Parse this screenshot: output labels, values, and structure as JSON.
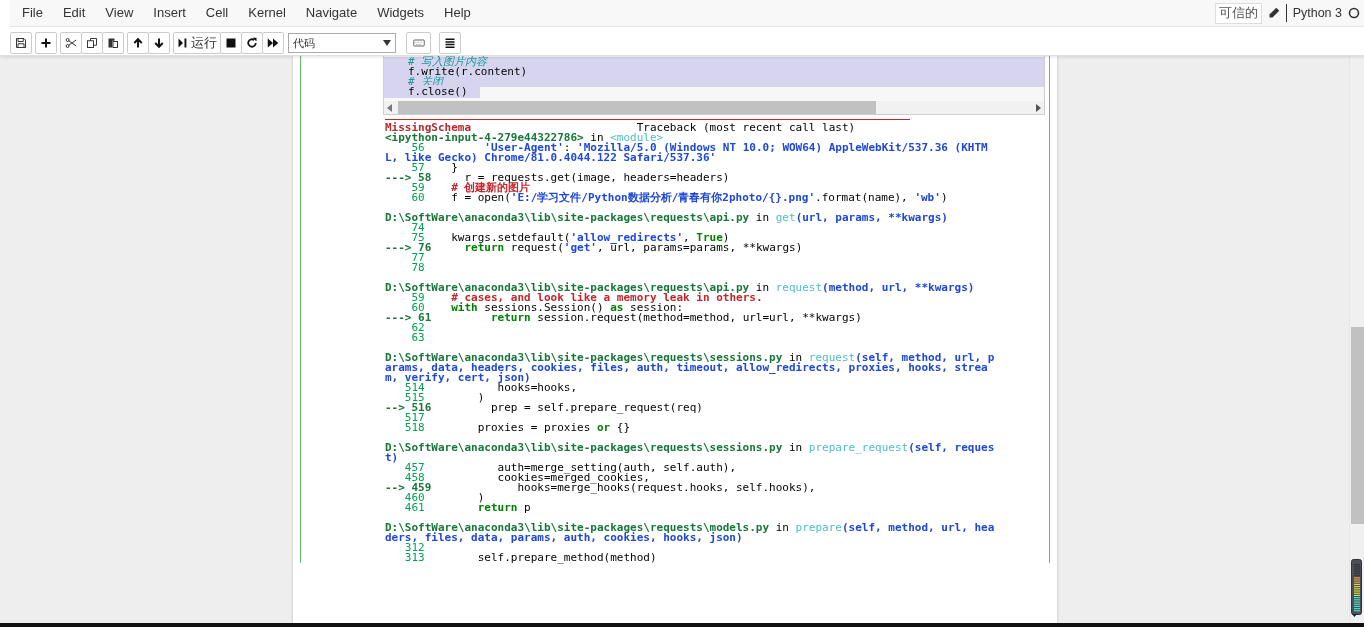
{
  "menu": [
    "File",
    "Edit",
    "View",
    "Insert",
    "Cell",
    "Kernel",
    "Navigate",
    "Widgets",
    "Help"
  ],
  "header": {
    "trusted": "可信的",
    "kernel_name": "Python 3",
    "kernel_busy": false
  },
  "toolbar": {
    "run_label": "运行",
    "cell_type": "代码"
  },
  "code_cell": {
    "lines": [
      {
        "kind": "comment",
        "text": "# 写入图片内容",
        "selected": true,
        "whole_line": true
      },
      {
        "kind": "code",
        "text": "f.write(r.content)",
        "selected": true,
        "whole_line": true
      },
      {
        "kind": "comment",
        "text": "# 关闭",
        "selected": true,
        "whole_line": true
      },
      {
        "kind": "code",
        "text": "f.close()",
        "selected": true,
        "whole_line": false
      }
    ]
  },
  "traceback": {
    "frames": [
      {
        "lines": [
          {
            "segments": [
              {
                "kind": "error",
                "text": "MissingSchema"
              },
              {
                "kind": "plain",
                "text": "                         Traceback (most recent call last)"
              }
            ]
          },
          {
            "segments": [
              {
                "kind": "file",
                "text": "<ipython-input-4-279e44322786>"
              },
              {
                "kind": "plain",
                "text": " in "
              },
              {
                "kind": "func",
                "text": "<module>"
              }
            ]
          },
          {
            "segments": [
              {
                "kind": "lineno",
                "text": "    56"
              },
              {
                "kind": "string",
                "text": "         'User-Agent'"
              },
              {
                "kind": "plain",
                "text": ": "
              },
              {
                "kind": "string",
                "text": "'Mozilla/5.0 (Windows NT 10.0; WOW64) AppleWebKit/537.36 (KHTM"
              }
            ]
          },
          {
            "segments": [
              {
                "kind": "string",
                "text": "L, like Gecko) Chrome/81.0.4044.122 Safari/537.36'"
              }
            ]
          },
          {
            "segments": [
              {
                "kind": "lineno",
                "text": "    57"
              },
              {
                "kind": "plain",
                "text": "    }"
              }
            ]
          },
          {
            "segments": [
              {
                "kind": "arrow",
                "text": "---> 58"
              },
              {
                "kind": "plain",
                "text": "     r = requests.get(image, headers=headers)"
              }
            ]
          },
          {
            "segments": [
              {
                "kind": "lineno",
                "text": "    59"
              },
              {
                "kind": "comment",
                "text": "    # 创建新的图片"
              }
            ]
          },
          {
            "segments": [
              {
                "kind": "lineno",
                "text": "    60"
              },
              {
                "kind": "plain",
                "text": "    f = open("
              },
              {
                "kind": "string",
                "text": "'E:/学习文件/Python数据分析/青春有你2photo/{}.png'"
              },
              {
                "kind": "plain",
                "text": ".format(name), "
              },
              {
                "kind": "string",
                "text": "'wb'"
              },
              {
                "kind": "plain",
                "text": ")"
              }
            ]
          }
        ]
      },
      {
        "lines": [
          {
            "segments": [
              {
                "kind": "file",
                "text": "D:\\SoftWare\\anaconda3\\lib\\site-packages\\requests\\api.py"
              },
              {
                "kind": "plain",
                "text": " in "
              },
              {
                "kind": "func",
                "text": "get"
              },
              {
                "kind": "args",
                "text": "(url, params, **kwargs)"
              }
            ]
          },
          {
            "segments": [
              {
                "kind": "lineno",
                "text": "    74"
              }
            ]
          },
          {
            "segments": [
              {
                "kind": "lineno",
                "text": "    75"
              },
              {
                "kind": "plain",
                "text": "    kwargs.setdefault("
              },
              {
                "kind": "string",
                "text": "'allow_redirects'"
              },
              {
                "kind": "plain",
                "text": ", "
              },
              {
                "kind": "keyword",
                "text": "True"
              },
              {
                "kind": "plain",
                "text": ")"
              }
            ]
          },
          {
            "segments": [
              {
                "kind": "arrow",
                "text": "---> 76"
              },
              {
                "kind": "keyword",
                "text": "     return"
              },
              {
                "kind": "plain",
                "text": " request("
              },
              {
                "kind": "string",
                "text": "'get'"
              },
              {
                "kind": "plain",
                "text": ", url, params=params, **kwargs)"
              }
            ]
          },
          {
            "segments": [
              {
                "kind": "lineno",
                "text": "    77"
              }
            ]
          },
          {
            "segments": [
              {
                "kind": "lineno",
                "text": "    78"
              }
            ]
          }
        ]
      },
      {
        "lines": [
          {
            "segments": [
              {
                "kind": "file",
                "text": "D:\\SoftWare\\anaconda3\\lib\\site-packages\\requests\\api.py"
              },
              {
                "kind": "plain",
                "text": " in "
              },
              {
                "kind": "func",
                "text": "request"
              },
              {
                "kind": "args",
                "text": "(method, url, **kwargs)"
              }
            ]
          },
          {
            "segments": [
              {
                "kind": "lineno",
                "text": "    59"
              },
              {
                "kind": "comment",
                "text": "    # cases, and look like a memory leak in others."
              }
            ]
          },
          {
            "segments": [
              {
                "kind": "lineno",
                "text": "    60"
              },
              {
                "kind": "keyword",
                "text": "    with"
              },
              {
                "kind": "plain",
                "text": " sessions.Session() "
              },
              {
                "kind": "keyword",
                "text": "as"
              },
              {
                "kind": "plain",
                "text": " session:"
              }
            ]
          },
          {
            "segments": [
              {
                "kind": "arrow",
                "text": "---> 61"
              },
              {
                "kind": "keyword",
                "text": "         return"
              },
              {
                "kind": "plain",
                "text": " session.request(method=method, url=url, **kwargs)"
              }
            ]
          },
          {
            "segments": [
              {
                "kind": "lineno",
                "text": "    62"
              }
            ]
          },
          {
            "segments": [
              {
                "kind": "lineno",
                "text": "    63"
              }
            ]
          }
        ]
      },
      {
        "lines": [
          {
            "segments": [
              {
                "kind": "file",
                "text": "D:\\SoftWare\\anaconda3\\lib\\site-packages\\requests\\sessions.py"
              },
              {
                "kind": "plain",
                "text": " in "
              },
              {
                "kind": "func",
                "text": "request"
              },
              {
                "kind": "args",
                "text": "(self, method, url, p"
              }
            ]
          },
          {
            "segments": [
              {
                "kind": "args",
                "text": "arams, data, headers, cookies, files, auth, timeout, allow_redirects, proxies, hooks, strea"
              }
            ]
          },
          {
            "segments": [
              {
                "kind": "args",
                "text": "m, verify, cert, json)"
              }
            ]
          },
          {
            "segments": [
              {
                "kind": "lineno",
                "text": "   514"
              },
              {
                "kind": "plain",
                "text": "           hooks=hooks,"
              }
            ]
          },
          {
            "segments": [
              {
                "kind": "lineno",
                "text": "   515"
              },
              {
                "kind": "plain",
                "text": "        )"
              }
            ]
          },
          {
            "segments": [
              {
                "kind": "arrow",
                "text": "--> 516"
              },
              {
                "kind": "plain",
                "text": "         prep = self.prepare_request(req)"
              }
            ]
          },
          {
            "segments": [
              {
                "kind": "lineno",
                "text": "   517"
              }
            ]
          },
          {
            "segments": [
              {
                "kind": "lineno",
                "text": "   518"
              },
              {
                "kind": "plain",
                "text": "        proxies = proxies "
              },
              {
                "kind": "keyword",
                "text": "or"
              },
              {
                "kind": "plain",
                "text": " {}"
              }
            ]
          }
        ]
      },
      {
        "lines": [
          {
            "segments": [
              {
                "kind": "file",
                "text": "D:\\SoftWare\\anaconda3\\lib\\site-packages\\requests\\sessions.py"
              },
              {
                "kind": "plain",
                "text": " in "
              },
              {
                "kind": "func",
                "text": "prepare_request"
              },
              {
                "kind": "args",
                "text": "(self, reques"
              }
            ]
          },
          {
            "segments": [
              {
                "kind": "args",
                "text": "t)"
              }
            ]
          },
          {
            "segments": [
              {
                "kind": "lineno",
                "text": "   457"
              },
              {
                "kind": "plain",
                "text": "           auth=merge_setting(auth, self.auth),"
              }
            ]
          },
          {
            "segments": [
              {
                "kind": "lineno",
                "text": "   458"
              },
              {
                "kind": "plain",
                "text": "           cookies=merged_cookies,"
              }
            ]
          },
          {
            "segments": [
              {
                "kind": "arrow",
                "text": "--> 459"
              },
              {
                "kind": "plain",
                "text": "             hooks=merge_hooks(request.hooks, self.hooks),"
              }
            ]
          },
          {
            "segments": [
              {
                "kind": "lineno",
                "text": "   460"
              },
              {
                "kind": "plain",
                "text": "        )"
              }
            ]
          },
          {
            "segments": [
              {
                "kind": "lineno",
                "text": "   461"
              },
              {
                "kind": "keyword",
                "text": "        return"
              },
              {
                "kind": "plain",
                "text": " p"
              }
            ]
          }
        ]
      },
      {
        "lines": [
          {
            "segments": [
              {
                "kind": "file",
                "text": "D:\\SoftWare\\anaconda3\\lib\\site-packages\\requests\\models.py"
              },
              {
                "kind": "plain",
                "text": " in "
              },
              {
                "kind": "func",
                "text": "prepare"
              },
              {
                "kind": "args",
                "text": "(self, method, url, hea"
              }
            ]
          },
          {
            "segments": [
              {
                "kind": "args",
                "text": "ders, files, data, params, auth, cookies, hooks, json)"
              }
            ]
          },
          {
            "segments": [
              {
                "kind": "lineno",
                "text": "   312"
              }
            ]
          },
          {
            "segments": [
              {
                "kind": "lineno",
                "text": "   313"
              },
              {
                "kind": "plain",
                "text": "        self.prepare_method(method)"
              }
            ]
          }
        ]
      }
    ]
  }
}
